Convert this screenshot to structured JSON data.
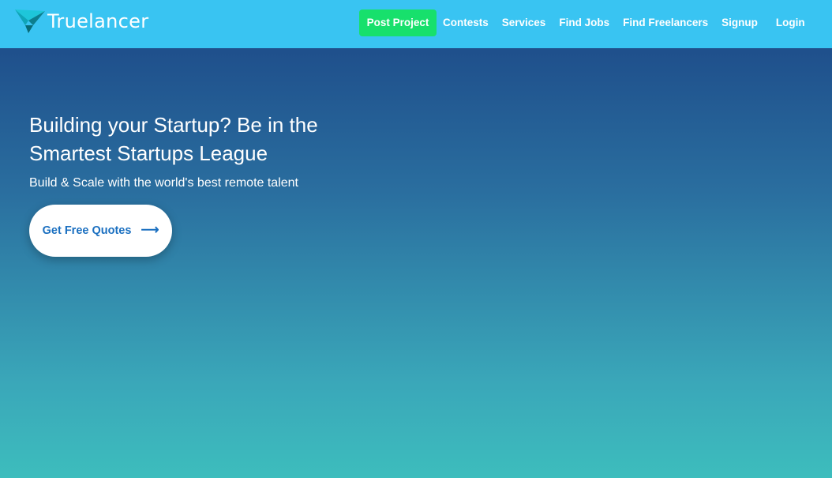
{
  "brand": {
    "name": "Truelancer",
    "logo_icon": "truelancer-logo-icon",
    "bar_color": "#39c4f2"
  },
  "nav": {
    "post_project": "Post Project",
    "contests": "Contests",
    "services": "Services",
    "find_jobs": "Find Jobs",
    "find_freelancers": "Find Freelancers",
    "signup": "Signup",
    "login": "Login",
    "post_project_color": "#17e06c"
  },
  "hero": {
    "title_line1": "Building your Startup? Be in the",
    "title_line2": "Smartest Startups League",
    "subtitle": "Build & Scale with the world's best remote talent",
    "cta_label": "Get Free Quotes",
    "cta_icon": "arrow-right-icon",
    "cta_text_color": "#1a6fc0"
  }
}
